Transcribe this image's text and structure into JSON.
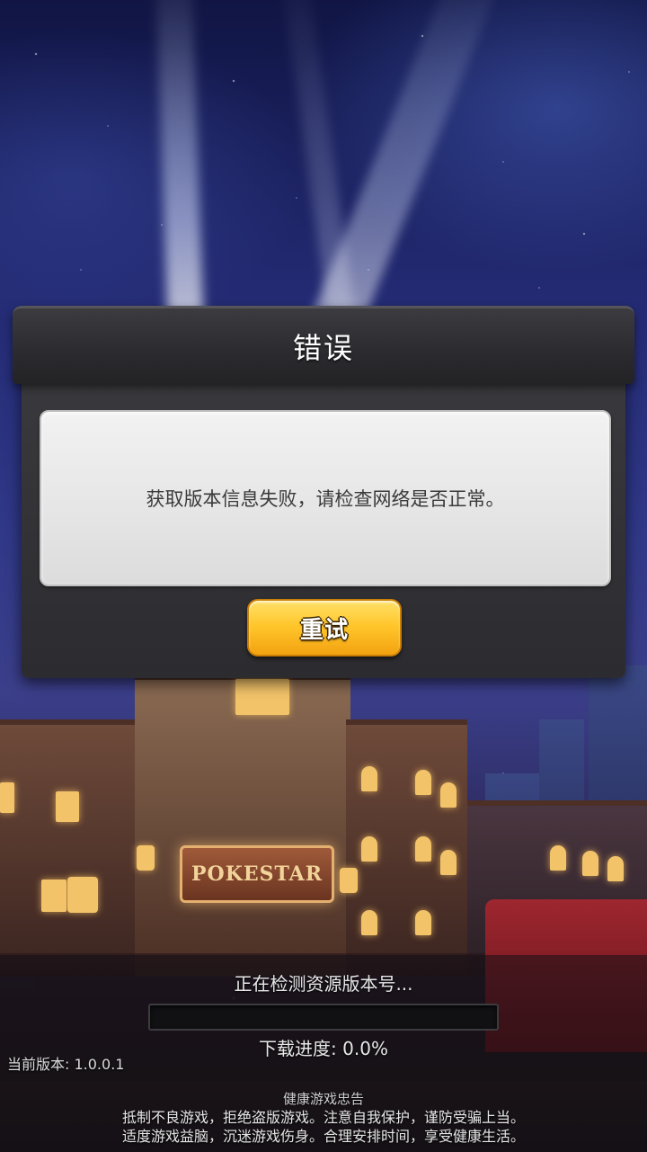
{
  "dialog": {
    "title": "错误",
    "message": "获取版本信息失败，请检查网络是否正常。",
    "retry_label": "重试"
  },
  "scene": {
    "sign_text": "POKESTAR"
  },
  "loading": {
    "status": "正在检测资源版本号...",
    "progress_label": "下载进度:  0.0%",
    "progress_percent": 0,
    "version": "当前版本: 1.0.0.1"
  },
  "notice": {
    "title": "健康游戏忠告",
    "line1": "抵制不良游戏，拒绝盗版游戏。注意自我保护，谨防受骗上当。",
    "line2": "适度游戏益脑，沉迷游戏伤身。合理安排时间，享受健康生活。"
  },
  "colors": {
    "dialog_bg": "#2c2c30",
    "button_accent": "#ffc72c",
    "message_bg": "#e6e6e6"
  }
}
